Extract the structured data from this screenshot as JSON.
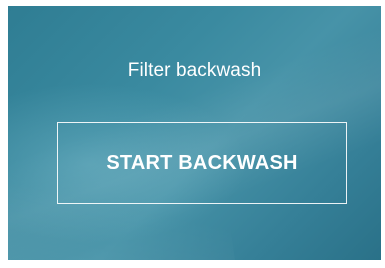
{
  "screen": {
    "title": "Filter backwash",
    "primary_button_label": "START BACKWASH"
  },
  "colors": {
    "panel_background": "#3a8aa0",
    "text": "#ffffff",
    "button_border": "#ffffff"
  }
}
